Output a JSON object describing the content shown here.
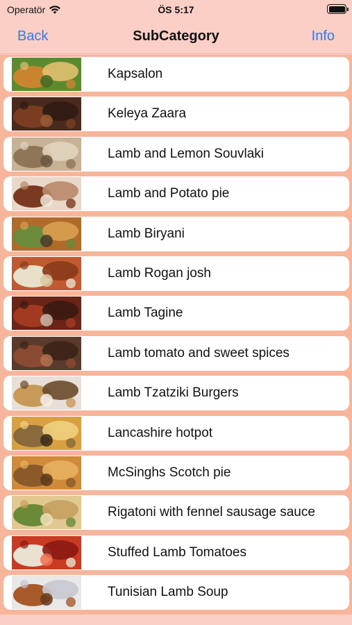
{
  "status": {
    "carrier": "Operatör",
    "time": "ÖS 5:17"
  },
  "nav": {
    "back_label": "Back",
    "title": "SubCategory",
    "info_label": "Info"
  },
  "items": [
    {
      "label": "Kapsalon",
      "colors": [
        "#5c8a2e",
        "#c9842f",
        "#e0c070",
        "#3f6b22"
      ]
    },
    {
      "label": "Keleya Zaara",
      "colors": [
        "#4a2a1d",
        "#7a3d22",
        "#2f1a12",
        "#9a5a34"
      ]
    },
    {
      "label": "Lamb and Lemon Souvlaki",
      "colors": [
        "#c8b296",
        "#8f7658",
        "#e1d3be",
        "#6b5640"
      ]
    },
    {
      "label": "Lamb and Potato pie",
      "colors": [
        "#e8d8c8",
        "#7a3a22",
        "#b98a6a",
        "#f2e6da"
      ]
    },
    {
      "label": "Lamb Biryani",
      "colors": [
        "#b06a2a",
        "#6b8a3a",
        "#d9a050",
        "#4a3a2a"
      ]
    },
    {
      "label": "Lamb Rogan josh",
      "colors": [
        "#c05a32",
        "#e8e0c8",
        "#8a3a1a",
        "#d8c8a0"
      ]
    },
    {
      "label": "Lamb Tagine",
      "colors": [
        "#6a2418",
        "#a23a22",
        "#3a1a12",
        "#c8b8a8"
      ]
    },
    {
      "label": "Lamb tomato and sweet spices",
      "colors": [
        "#5a3a2a",
        "#8a4a32",
        "#3a2418",
        "#b07050"
      ]
    },
    {
      "label": "Lamb Tzatziki Burgers",
      "colors": [
        "#e8e0d8",
        "#c89a5a",
        "#6a4a2a",
        "#f4f0ea"
      ]
    },
    {
      "label": "Lancashire hotpot",
      "colors": [
        "#d8a040",
        "#8a6a3a",
        "#f0d080",
        "#3a2a1a"
      ]
    },
    {
      "label": "McSinghs Scotch pie",
      "colors": [
        "#d08a3a",
        "#8a5a2a",
        "#e8b060",
        "#5a3a1a"
      ]
    },
    {
      "label": "Rigatoni with fennel sausage sauce",
      "colors": [
        "#e0c890",
        "#6a8a3a",
        "#c8a060",
        "#f0e0b8"
      ]
    },
    {
      "label": "Stuffed Lamb Tomatoes",
      "colors": [
        "#c83a22",
        "#e8e0d0",
        "#8a1a12",
        "#f07050"
      ]
    },
    {
      "label": "Tunisian Lamb Soup",
      "colors": [
        "#e8e8e8",
        "#a85a2a",
        "#c8c8d0",
        "#6a3a1a"
      ]
    }
  ]
}
